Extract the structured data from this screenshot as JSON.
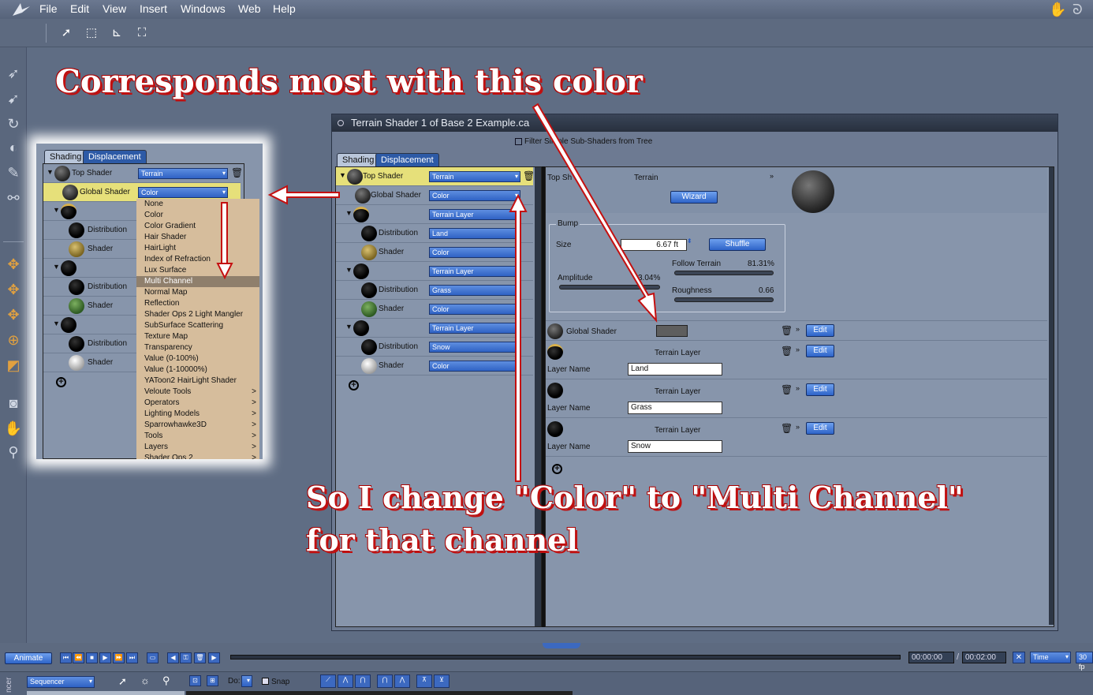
{
  "menubar": {
    "items": [
      "File",
      "Edit",
      "View",
      "Insert",
      "Windows",
      "Web",
      "Help"
    ]
  },
  "annotations": {
    "top": "Corresponds most with this color",
    "bottom_line1": "So I change \"Color\" to \"Multi Channel\"",
    "bottom_line2": "for that channel"
  },
  "window": {
    "title": "Terrain Shader 1 of Base 2 Example.ca",
    "filter_label": "Filter Simple Sub-Shaders from Tree",
    "tabs": [
      "Shading",
      "Displacement"
    ],
    "tree": [
      {
        "label": "Top Shader",
        "value": "Terrain",
        "ball": "dark"
      },
      {
        "label": "Global Shader",
        "value": "Color",
        "ball": "dark"
      },
      {
        "label": "",
        "value": "Terrain Layer",
        "ball": "cap"
      },
      {
        "label": "Distribution",
        "value": "Land",
        "ball": "black"
      },
      {
        "label": "Shader",
        "value": "Color",
        "ball": "gold"
      },
      {
        "label": "",
        "value": "Terrain Layer",
        "ball": "black"
      },
      {
        "label": "Distribution",
        "value": "Grass",
        "ball": "black"
      },
      {
        "label": "Shader",
        "value": "Color",
        "ball": "green"
      },
      {
        "label": "",
        "value": "Terrain Layer",
        "ball": "black"
      },
      {
        "label": "Distribution",
        "value": "Snow",
        "ball": "black"
      },
      {
        "label": "Shader",
        "value": "Color",
        "ball": "white"
      }
    ],
    "detail": {
      "top_shader_label": "Top Sh",
      "top_shader_value": "Terrain",
      "wizard": "Wizard",
      "bump_label": "Bump",
      "size_label": "Size",
      "size_value": "6.67 ft",
      "shuffle": "Shuffle",
      "follow_terrain_label": "Follow Terrain",
      "follow_terrain_value": "81.31%",
      "amplitude_label": "Amplitude",
      "amplitude_value": "3.04%",
      "roughness_label": "Roughness",
      "roughness_value": "0.66",
      "global_shader_label": "Global Shader",
      "edit": "Edit",
      "layers": [
        {
          "title": "Terrain Layer",
          "name_label": "Layer Name",
          "name": "Land"
        },
        {
          "title": "Terrain Layer",
          "name_label": "Layer Name",
          "name": "Grass"
        },
        {
          "title": "Terrain Layer",
          "name_label": "Layer Name",
          "name": "Snow"
        }
      ]
    }
  },
  "zoom": {
    "tabs": [
      "Shading",
      "Displacement"
    ],
    "tree": [
      {
        "label": "Top Shader",
        "value": "Terrain"
      },
      {
        "label": "Global Shader",
        "value": "Color"
      },
      {
        "label": "Distribution"
      },
      {
        "label": "Shader"
      },
      {
        "label": "Distribution"
      },
      {
        "label": "Shader"
      },
      {
        "label": "Distribution"
      },
      {
        "label": "Shader"
      }
    ],
    "menu": [
      {
        "label": "None"
      },
      {
        "label": "Color"
      },
      {
        "label": "Color Gradient"
      },
      {
        "label": "Hair Shader"
      },
      {
        "label": "HairLight"
      },
      {
        "label": "Index of Refraction"
      },
      {
        "label": "Lux Surface"
      },
      {
        "label": "Multi Channel",
        "selected": true
      },
      {
        "label": "Normal Map"
      },
      {
        "label": "Reflection"
      },
      {
        "label": "Shader Ops 2 Light Mangler"
      },
      {
        "label": "SubSurface Scattering"
      },
      {
        "label": "Texture Map"
      },
      {
        "label": "Transparency"
      },
      {
        "label": "Value (0-100%)"
      },
      {
        "label": "Value (1-10000%)"
      },
      {
        "label": "YAToon2 HairLight Shader"
      },
      {
        "label": "Veloute Tools",
        "sub": ">"
      },
      {
        "label": "Operators",
        "sub": ">"
      },
      {
        "label": "Lighting Models",
        "sub": ">"
      },
      {
        "label": "Sparrowhawke3D",
        "sub": ">"
      },
      {
        "label": "Tools",
        "sub": ">"
      },
      {
        "label": "Layers",
        "sub": ">"
      },
      {
        "label": "Shader Ops 2",
        "sub": ">"
      }
    ]
  },
  "timeline": {
    "animate": "Animate",
    "time_current": "00:00:00",
    "time_total": "00:02:00",
    "time_mode": "Time",
    "fps": "30 fp",
    "sequencer": "Sequencer",
    "do_label": "Do:",
    "snap": "Snap",
    "side_label": "ncer"
  },
  "colors": {
    "highlight_row": "#e6e07a",
    "menu_bg": "#d6bd9c",
    "annotation_red": "#c01010"
  }
}
